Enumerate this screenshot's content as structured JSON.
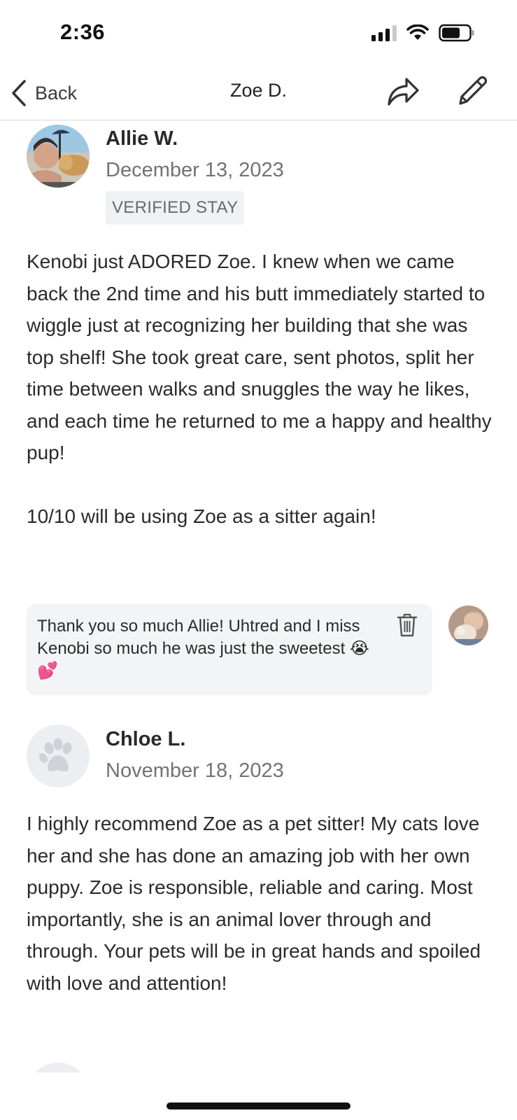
{
  "status_bar": {
    "time": "2:36"
  },
  "nav": {
    "back_label": "Back",
    "title": "Zoe D.",
    "share_icon": "share-arrow-icon",
    "edit_icon": "pencil-icon"
  },
  "reviews": [
    {
      "name": "Allie W.",
      "date": "December 13, 2023",
      "badge": "VERIFIED STAY",
      "text": "Kenobi just ADORED Zoe. I knew when we came back the 2nd time and his butt immediately started to wiggle just at recognizing her building that she was top shelf! She took great care, sent photos, split her time between walks and snuggles the way he likes, and each time he returned to me a happy and healthy pup!\n\n10/10 will be using Zoe as a sitter again!",
      "reply": {
        "text": "Thank you so much Allie! Uhtred and I miss Kenobi so much he was just the sweetest 😭💕"
      }
    },
    {
      "name": "Chloe L.",
      "date": "November 18, 2023",
      "text": "I highly recommend Zoe as a pet sitter! My cats love her and she has done an amazing job with her own puppy. Zoe is responsible, reliable and caring. Most importantly, she is an animal lover through and through. Your pets will be in great hands and spoiled with love and attention!",
      "avatar_icon": "paw-icon"
    }
  ],
  "colors": {
    "badge_bg": "#f0f1f3",
    "reply_bg": "#f3f4f6",
    "muted_text": "#737373"
  }
}
